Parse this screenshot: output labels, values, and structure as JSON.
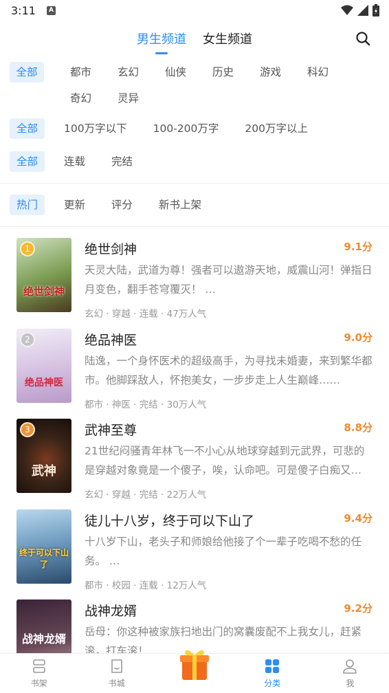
{
  "status": {
    "time": "3:11",
    "badge": "A"
  },
  "header": {
    "tabs": [
      {
        "label": "男生频道",
        "active": true
      },
      {
        "label": "女生频道",
        "active": false
      }
    ]
  },
  "filters": {
    "category": [
      "全部",
      "都市",
      "玄幻",
      "仙侠",
      "历史",
      "游戏",
      "科幻",
      "奇幻",
      "灵异"
    ],
    "word_count": [
      "全部",
      "100万字以下",
      "100-200万字",
      "200万字以上"
    ],
    "status": [
      "全部",
      "连载",
      "完结"
    ],
    "sort": [
      "热门",
      "更新",
      "评分",
      "新书上架"
    ]
  },
  "books": [
    {
      "rank": "1",
      "title": "绝世剑神",
      "score": "9.1分",
      "desc": "天灵大陆，武道为尊！强者可以遨游天地，威震山河！弹指日月变色，翻手苍穹覆灭！ …",
      "meta": "玄幻 · 穿越 · 连载 · 47万人气",
      "cover_text": "绝世剑神",
      "cover_colors": [
        "#a8c8a0",
        "#5b7b3a"
      ]
    },
    {
      "rank": "2",
      "title": "绝品神医",
      "score": "9.0分",
      "desc": "陆逸，一个身怀医术的超级高手，为寻找未婚妻，来到繁华都市。他脚踩敌人，怀抱美女，一步步走上人生巅峰……",
      "meta": "都市 · 神医 · 完结 · 30万人气",
      "cover_text": "绝品神医",
      "cover_colors": [
        "#e8e4f0",
        "#c4a8d8"
      ]
    },
    {
      "rank": "3",
      "title": "武神至尊",
      "score": "8.8分",
      "desc": "21世纪闷骚青年林飞一不小心从地球穿越到元武界，可悲的是穿越对象竟是一个傻子，唉，认命吧。可是傻子白痴又…",
      "meta": "玄幻 · 穿越 · 完结 · 22万人气",
      "cover_text": "武神",
      "cover_colors": [
        "#3a2a20",
        "#1a1410"
      ]
    },
    {
      "rank": "",
      "title": "徒儿十八岁，终于可以下山了",
      "score": "9.4分",
      "desc": "十八岁下山，老头子和师娘给他接了个一辈子吃喝不愁的任务。 …",
      "meta": "都市 · 校园 · 连载 · 12万人气",
      "cover_text": "终于可以下山了",
      "cover_colors": [
        "#8ab8d8",
        "#3a6890"
      ]
    },
    {
      "rank": "",
      "title": "战神龙婿",
      "score": "9.2分",
      "desc": "岳母：你这种被家族扫地出门的窝囊废配不上我女儿，赶紧滚，打车滚！…",
      "meta": "",
      "cover_text": "战神龙婿",
      "cover_colors": [
        "#2a1a2a",
        "#5a3a4a"
      ]
    }
  ],
  "nav": [
    {
      "label": "书架",
      "icon": "bookshelf-icon",
      "active": false
    },
    {
      "label": "书城",
      "icon": "bookstore-icon",
      "active": false
    },
    {
      "label": "",
      "icon": "gift-icon",
      "active": false
    },
    {
      "label": "分类",
      "icon": "category-icon",
      "active": true
    },
    {
      "label": "我",
      "icon": "profile-icon",
      "active": false
    }
  ],
  "colors": {
    "accent": "#2c8df5",
    "score": "#f08a2c"
  }
}
